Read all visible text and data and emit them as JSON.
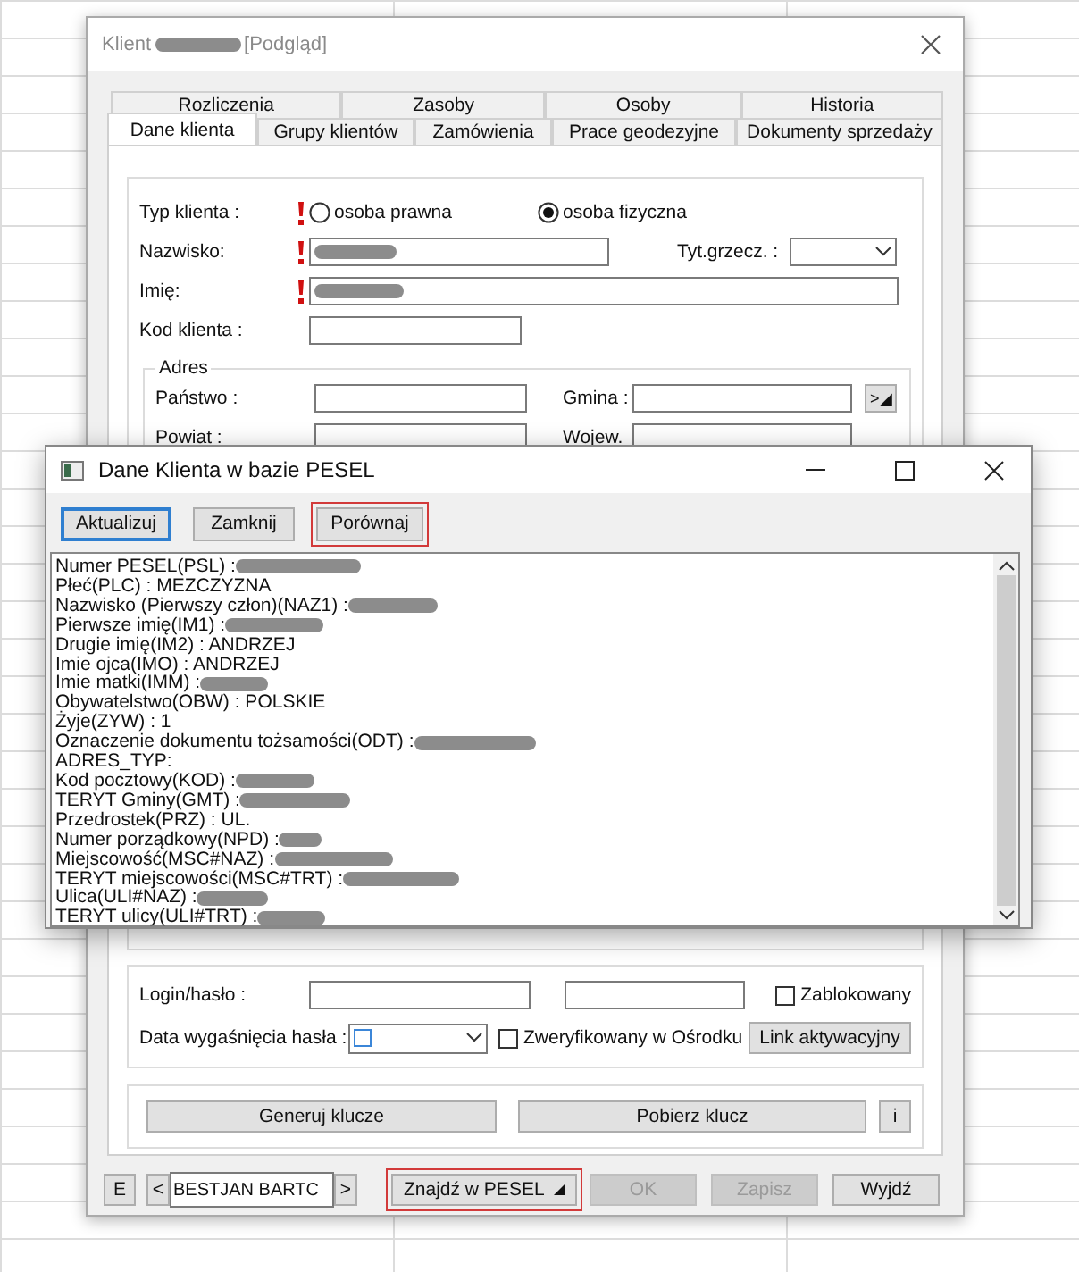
{
  "main_window": {
    "title": "Klient",
    "title_redacted": true,
    "title_suffix": "[Podgląd]"
  },
  "tab_rows": [
    [
      {
        "label": "Rozliczenia",
        "selected": false
      },
      {
        "label": "Zasoby",
        "selected": false
      },
      {
        "label": "Osoby",
        "selected": false
      },
      {
        "label": "Historia",
        "selected": false
      }
    ],
    [
      {
        "label": "Dane klienta",
        "selected": true
      },
      {
        "label": "Grupy klientów",
        "selected": false
      },
      {
        "label": "Zamówienia",
        "selected": false
      },
      {
        "label": "Prace geodezyjne",
        "selected": false
      },
      {
        "label": "Dokumenty sprzedaży",
        "selected": false
      }
    ]
  ],
  "client_type": {
    "label": "Typ klienta :",
    "required": true,
    "options": [
      {
        "label": "osoba prawna",
        "selected": false
      },
      {
        "label": "osoba fizyczna",
        "selected": true
      }
    ]
  },
  "surname": {
    "label": "Nazwisko:",
    "required": true,
    "redacted": true
  },
  "title_select": {
    "label": "Tyt.grzecz. :"
  },
  "first_name": {
    "label": "Imię:",
    "required": true,
    "redacted": true
  },
  "client_code": {
    "label": "Kod klienta :"
  },
  "address": {
    "legend": "Adres",
    "fields": [
      {
        "label": "Państwo :"
      },
      {
        "label": "Gmina :"
      },
      {
        "label": "Powiat :"
      },
      {
        "label": "Wojew."
      }
    ],
    "picker_button": ">◢"
  },
  "login": {
    "label": "Login/hasło :",
    "blocked": {
      "label": "Zablokowany",
      "checked": false
    },
    "expiry_label": "Data wygaśnięcia hasła :",
    "expiry_checked": false,
    "verified": {
      "label": "Zweryfikowany w Ośrodku",
      "checked": false
    },
    "link_button": "Link aktywacyjny"
  },
  "key_buttons": [
    "Generuj klucze",
    "Pobierz klucz",
    "i"
  ],
  "bottom": {
    "e_button": "E",
    "prev": "<",
    "record": "BESTJAN BARTC",
    "next": ">",
    "find": {
      "label": "Znajdź w PESEL",
      "highlighted": true
    },
    "buttons": [
      {
        "label": "OK",
        "disabled": true
      },
      {
        "label": "Zapisz",
        "disabled": true
      },
      {
        "label": "Wyjdź",
        "disabled": false
      }
    ]
  },
  "dialog": {
    "title": "Dane Klienta w bazie PESEL",
    "buttons": [
      {
        "label": "Aktualizuj",
        "focused": true,
        "highlighted": false
      },
      {
        "label": "Zamknij",
        "focused": false,
        "highlighted": false
      },
      {
        "label": "Porównaj",
        "focused": false,
        "highlighted": true
      }
    ],
    "lines": [
      {
        "text": "Numer PESEL(PSL) :",
        "redacted": true
      },
      {
        "text": "Płeć(PLC) : MEZCZYZNA",
        "redacted": false
      },
      {
        "text": "Nazwisko (Pierwszy człon)(NAZ1) :",
        "redacted": true
      },
      {
        "text": "Pierwsze imię(IM1) :",
        "redacted": true
      },
      {
        "text": "Drugie imię(IM2) : ANDRZEJ",
        "redacted": false
      },
      {
        "text": "Imie ojca(IMO) : ANDRZEJ",
        "redacted": false
      },
      {
        "text": "Imie matki(IMM) :",
        "redacted": true
      },
      {
        "text": "Obywatelstwo(OBW) : POLSKIE",
        "redacted": false
      },
      {
        "text": "Żyje(ZYW) : 1",
        "redacted": false
      },
      {
        "text": "Oznaczenie dokumentu tożsamości(ODT) :",
        "redacted": true
      },
      {
        "text": "ADRES_TYP:",
        "redacted": false
      },
      {
        "text": "Kod pocztowy(KOD) :",
        "redacted": true
      },
      {
        "text": "TERYT Gminy(GMT) :",
        "redacted": true
      },
      {
        "text": "Przedrostek(PRZ) : UL.",
        "redacted": false
      },
      {
        "text": "Numer porządkowy(NPD) :",
        "redacted": true
      },
      {
        "text": "Miejscowość(MSC#NAZ) :",
        "redacted": true
      },
      {
        "text": "TERYT miejscowości(MSC#TRT) :",
        "redacted": true
      },
      {
        "text": "Ulica(ULI#NAZ) :",
        "redacted": true
      },
      {
        "text": "TERYT ulicy(ULI#TRT) :",
        "redacted": true
      }
    ]
  }
}
